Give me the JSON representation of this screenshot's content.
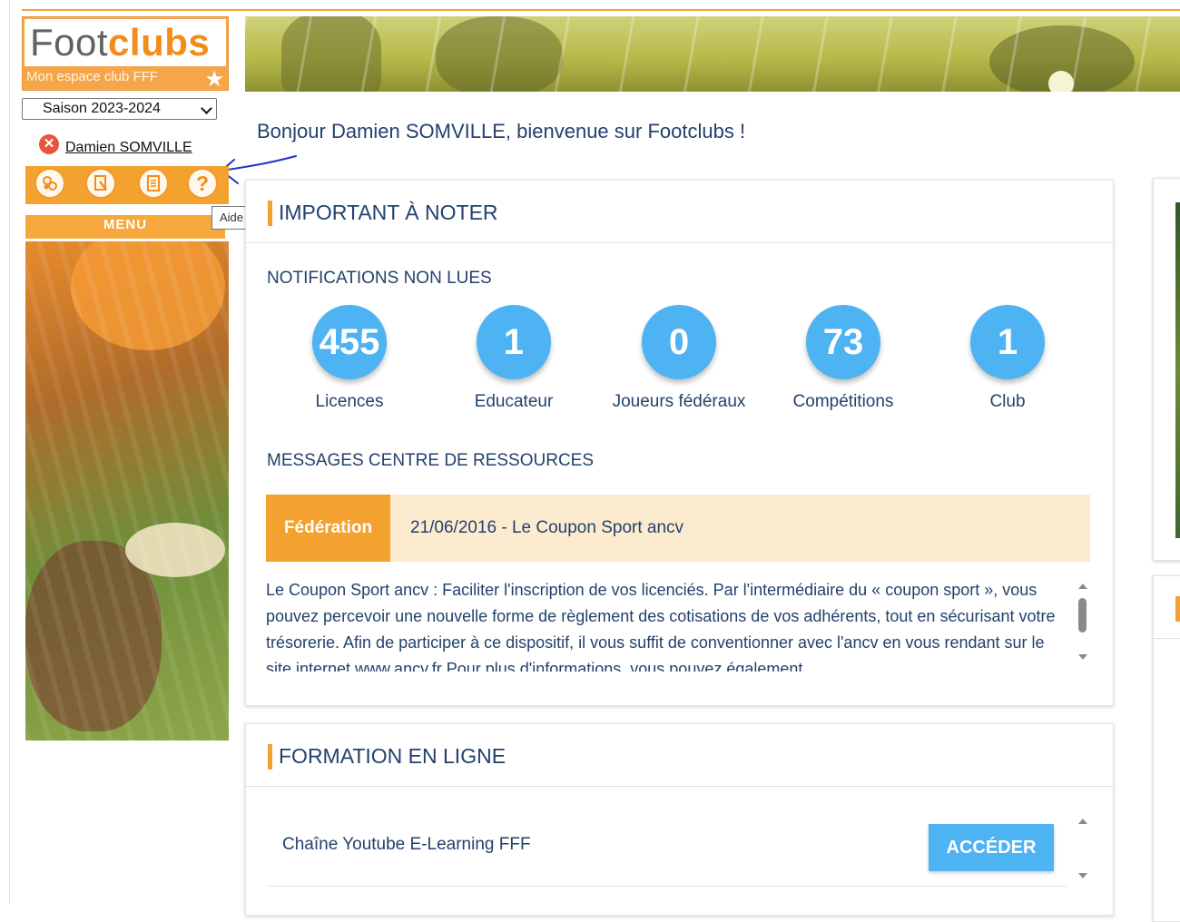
{
  "logo": {
    "word_foot": "Foot",
    "word_clubs": "clubs",
    "tagline": "Mon espace club FFF"
  },
  "season_select": {
    "value": "Saison 2023-2024"
  },
  "user": {
    "name": "Damien SOMVILLE"
  },
  "toolbar": {
    "icons": [
      "club-icon",
      "document-search-icon",
      "notes-icon",
      "help-icon"
    ],
    "help_glyph": "?",
    "tooltip": "Aide"
  },
  "menu": {
    "label": "MENU"
  },
  "welcome": "Bonjour Damien SOMVILLE, bienvenue sur Footclubs !",
  "important": {
    "title": "IMPORTANT À NOTER",
    "notifications_title": "NOTIFICATIONS NON LUES",
    "notifications": [
      {
        "count": "455",
        "label": "Licences"
      },
      {
        "count": "1",
        "label": "Educateur"
      },
      {
        "count": "0",
        "label": "Joueurs fédéraux"
      },
      {
        "count": "73",
        "label": "Compétitions"
      },
      {
        "count": "1",
        "label": "Club"
      }
    ],
    "messages_title": "MESSAGES CENTRE DE RESSOURCES",
    "message": {
      "tag": "Fédération",
      "title": "21/06/2016 - Le Coupon Sport ancv",
      "body": "Le Coupon Sport ancv : Faciliter l'inscription de vos licenciés. Par l'intermédiaire du « coupon sport », vous pouvez percevoir une nouvelle forme de règlement des cotisations de vos adhérents, tout en sécurisant votre trésorerie. Afin de participer à ce dispositif, il vous suffit de conventionner avec l'ancv en vous rendant sur le site internet www.ancv.fr Pour plus d'informations, vous pouvez également"
    }
  },
  "formation": {
    "title": "FORMATION EN LIGNE",
    "item_label": "Chaîne Youtube E-Learning FFF",
    "button": "ACCÉDER"
  },
  "colors": {
    "accent_orange": "#f3a12f",
    "bubble_blue": "#4db3f2",
    "text_navy": "#23416c"
  }
}
